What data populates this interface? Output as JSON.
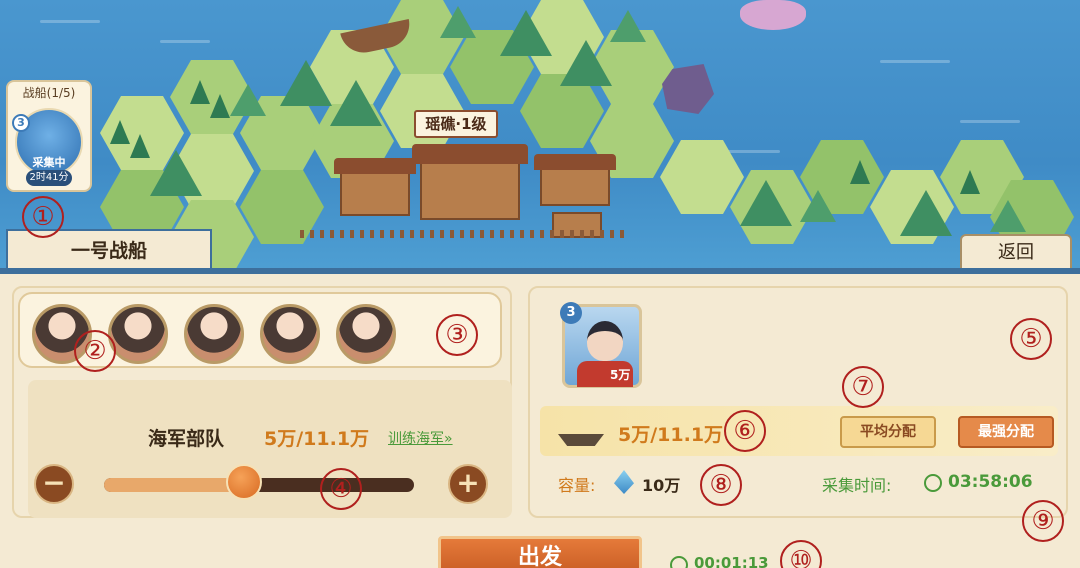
{
  "map": {
    "town_name": "瑶礁·1级",
    "ship_card": {
      "title": "战船(1/5)",
      "level": "3",
      "status": "采集中",
      "timer": "2时41分"
    },
    "ship_tab_label": "一号战船",
    "return_label": "返回"
  },
  "markers": [
    "①",
    "②",
    "③",
    "④",
    "⑤",
    "⑥",
    "⑦",
    "⑧",
    "⑨",
    "⑩"
  ],
  "heroes": {
    "portraits": [
      "hero-1",
      "hero-2",
      "hero-3",
      "hero-4",
      "hero-5"
    ]
  },
  "troops": {
    "label": "海军部队",
    "value": "5万/11.1万",
    "train_link": "训练海军»",
    "minus": "−",
    "plus": "+",
    "slider_fraction": 0.45
  },
  "commander": {
    "level": "3",
    "troops": "5万"
  },
  "naval": {
    "value": "5万/11.1万",
    "avg_button": "平均分配",
    "max_button": "最强分配"
  },
  "capacity": {
    "label": "容量:",
    "value": "10万"
  },
  "gather": {
    "label": "采集时间:",
    "value": "03:58:06"
  },
  "depart": {
    "label": "出发",
    "march_time": "00:01:13"
  },
  "colors": {
    "accent_orange": "#d07a1c",
    "green_text": "#4a9a3a",
    "marker_red": "#b0201e",
    "sea_blue": "#4a97cf"
  }
}
